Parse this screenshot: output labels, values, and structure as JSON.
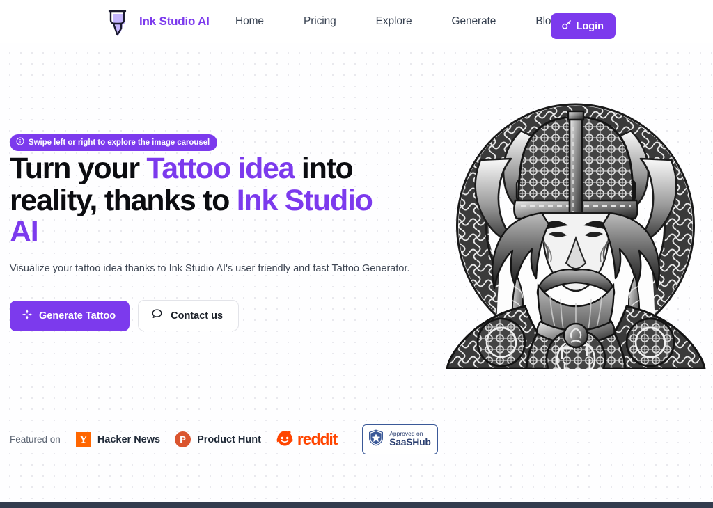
{
  "header": {
    "brand_name": "Ink Studio AI",
    "logo_icon": "marker-pen-icon",
    "nav": [
      {
        "label": "Home"
      },
      {
        "label": "Pricing"
      },
      {
        "label": "Explore"
      },
      {
        "label": "Generate"
      },
      {
        "label": "Blog"
      }
    ],
    "login": {
      "label": "Login",
      "icon": "key-icon",
      "color": "#7c3aed"
    }
  },
  "hero": {
    "badge": {
      "icon": "info-circle-icon",
      "text": "Swipe left or right to explore the image carousel",
      "color": "#7c3aed"
    },
    "headline": {
      "part1": "Turn your ",
      "accent1": "Tattoo idea",
      "part2": " into reality, thanks to ",
      "accent2": "Ink Studio AI"
    },
    "subtitle": "Visualize your tattoo idea thanks to Ink Studio AI's user friendly and fast Tattoo Generator.",
    "primary_cta": {
      "label": "Generate Tattoo",
      "icon": "sparkle-icon"
    },
    "secondary_cta": {
      "label": "Contact us",
      "icon": "chat-bubble-icon"
    },
    "carousel_image_alt": "viking-warrior-tattoo-illustration"
  },
  "featured": {
    "label": "Featured on",
    "items": [
      {
        "name": "Hacker News",
        "mark": "Y",
        "icon": "hacker-news-icon",
        "color": "#ff6600"
      },
      {
        "name": "Product Hunt",
        "mark": "P",
        "icon": "product-hunt-icon",
        "color": "#da552f"
      },
      {
        "name": "reddit",
        "icon": "reddit-icon",
        "color": "#ff4500"
      }
    ],
    "saashub": {
      "icon": "shield-star-icon",
      "line1": "Approved on",
      "line2": "SaaSHub",
      "color": "#3b5998"
    }
  },
  "footer": {
    "color": "#333c4e"
  }
}
